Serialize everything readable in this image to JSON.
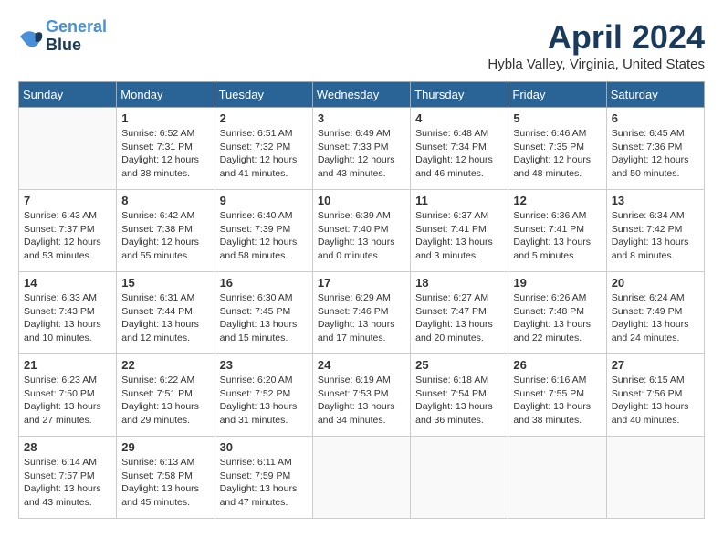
{
  "header": {
    "logo_line1": "General",
    "logo_line2": "Blue",
    "month": "April 2024",
    "location": "Hybla Valley, Virginia, United States"
  },
  "days_of_week": [
    "Sunday",
    "Monday",
    "Tuesday",
    "Wednesday",
    "Thursday",
    "Friday",
    "Saturday"
  ],
  "weeks": [
    [
      {
        "day": "",
        "info": ""
      },
      {
        "day": "1",
        "info": "Sunrise: 6:52 AM\nSunset: 7:31 PM\nDaylight: 12 hours\nand 38 minutes."
      },
      {
        "day": "2",
        "info": "Sunrise: 6:51 AM\nSunset: 7:32 PM\nDaylight: 12 hours\nand 41 minutes."
      },
      {
        "day": "3",
        "info": "Sunrise: 6:49 AM\nSunset: 7:33 PM\nDaylight: 12 hours\nand 43 minutes."
      },
      {
        "day": "4",
        "info": "Sunrise: 6:48 AM\nSunset: 7:34 PM\nDaylight: 12 hours\nand 46 minutes."
      },
      {
        "day": "5",
        "info": "Sunrise: 6:46 AM\nSunset: 7:35 PM\nDaylight: 12 hours\nand 48 minutes."
      },
      {
        "day": "6",
        "info": "Sunrise: 6:45 AM\nSunset: 7:36 PM\nDaylight: 12 hours\nand 50 minutes."
      }
    ],
    [
      {
        "day": "7",
        "info": "Sunrise: 6:43 AM\nSunset: 7:37 PM\nDaylight: 12 hours\nand 53 minutes."
      },
      {
        "day": "8",
        "info": "Sunrise: 6:42 AM\nSunset: 7:38 PM\nDaylight: 12 hours\nand 55 minutes."
      },
      {
        "day": "9",
        "info": "Sunrise: 6:40 AM\nSunset: 7:39 PM\nDaylight: 12 hours\nand 58 minutes."
      },
      {
        "day": "10",
        "info": "Sunrise: 6:39 AM\nSunset: 7:40 PM\nDaylight: 13 hours\nand 0 minutes."
      },
      {
        "day": "11",
        "info": "Sunrise: 6:37 AM\nSunset: 7:41 PM\nDaylight: 13 hours\nand 3 minutes."
      },
      {
        "day": "12",
        "info": "Sunrise: 6:36 AM\nSunset: 7:41 PM\nDaylight: 13 hours\nand 5 minutes."
      },
      {
        "day": "13",
        "info": "Sunrise: 6:34 AM\nSunset: 7:42 PM\nDaylight: 13 hours\nand 8 minutes."
      }
    ],
    [
      {
        "day": "14",
        "info": "Sunrise: 6:33 AM\nSunset: 7:43 PM\nDaylight: 13 hours\nand 10 minutes."
      },
      {
        "day": "15",
        "info": "Sunrise: 6:31 AM\nSunset: 7:44 PM\nDaylight: 13 hours\nand 12 minutes."
      },
      {
        "day": "16",
        "info": "Sunrise: 6:30 AM\nSunset: 7:45 PM\nDaylight: 13 hours\nand 15 minutes."
      },
      {
        "day": "17",
        "info": "Sunrise: 6:29 AM\nSunset: 7:46 PM\nDaylight: 13 hours\nand 17 minutes."
      },
      {
        "day": "18",
        "info": "Sunrise: 6:27 AM\nSunset: 7:47 PM\nDaylight: 13 hours\nand 20 minutes."
      },
      {
        "day": "19",
        "info": "Sunrise: 6:26 AM\nSunset: 7:48 PM\nDaylight: 13 hours\nand 22 minutes."
      },
      {
        "day": "20",
        "info": "Sunrise: 6:24 AM\nSunset: 7:49 PM\nDaylight: 13 hours\nand 24 minutes."
      }
    ],
    [
      {
        "day": "21",
        "info": "Sunrise: 6:23 AM\nSunset: 7:50 PM\nDaylight: 13 hours\nand 27 minutes."
      },
      {
        "day": "22",
        "info": "Sunrise: 6:22 AM\nSunset: 7:51 PM\nDaylight: 13 hours\nand 29 minutes."
      },
      {
        "day": "23",
        "info": "Sunrise: 6:20 AM\nSunset: 7:52 PM\nDaylight: 13 hours\nand 31 minutes."
      },
      {
        "day": "24",
        "info": "Sunrise: 6:19 AM\nSunset: 7:53 PM\nDaylight: 13 hours\nand 34 minutes."
      },
      {
        "day": "25",
        "info": "Sunrise: 6:18 AM\nSunset: 7:54 PM\nDaylight: 13 hours\nand 36 minutes."
      },
      {
        "day": "26",
        "info": "Sunrise: 6:16 AM\nSunset: 7:55 PM\nDaylight: 13 hours\nand 38 minutes."
      },
      {
        "day": "27",
        "info": "Sunrise: 6:15 AM\nSunset: 7:56 PM\nDaylight: 13 hours\nand 40 minutes."
      }
    ],
    [
      {
        "day": "28",
        "info": "Sunrise: 6:14 AM\nSunset: 7:57 PM\nDaylight: 13 hours\nand 43 minutes."
      },
      {
        "day": "29",
        "info": "Sunrise: 6:13 AM\nSunset: 7:58 PM\nDaylight: 13 hours\nand 45 minutes."
      },
      {
        "day": "30",
        "info": "Sunrise: 6:11 AM\nSunset: 7:59 PM\nDaylight: 13 hours\nand 47 minutes."
      },
      {
        "day": "",
        "info": ""
      },
      {
        "day": "",
        "info": ""
      },
      {
        "day": "",
        "info": ""
      },
      {
        "day": "",
        "info": ""
      }
    ]
  ]
}
